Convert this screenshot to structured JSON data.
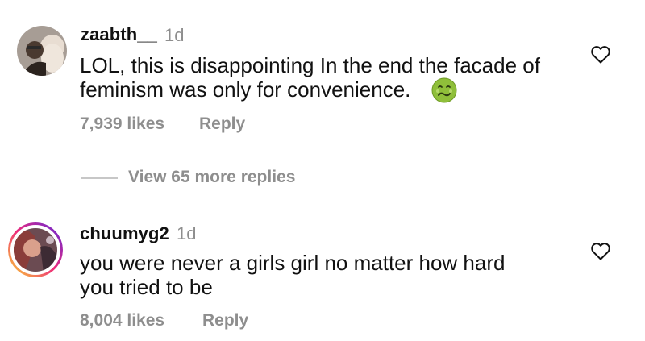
{
  "comments": [
    {
      "username": "zaabth__",
      "age": "1d",
      "text_lines": [
        "LOL, this is disappointing In the end the facade of",
        "feminism was only for convenience."
      ],
      "emoji": "nauseated-face",
      "likes": "7,939 likes",
      "reply_label": "Reply",
      "heart_icon": "heart-outline-icon"
    },
    {
      "username": "chuumyg2",
      "age": "1d",
      "text_lines": [
        "you were never a girls girl no matter how hard",
        "you tried to be"
      ],
      "likes": "8,004 likes",
      "reply_label": "Reply",
      "heart_icon": "heart-outline-icon",
      "story_ring": true
    }
  ],
  "thread": {
    "view_more_label": "View 65 more replies"
  },
  "colors": {
    "text": "#111111",
    "secondary": "#8e8e8e",
    "emoji_green": "#8fbf3a",
    "ring_start": "#f9ce34",
    "ring_mid": "#ee2a7b",
    "ring_end": "#6228d7"
  }
}
